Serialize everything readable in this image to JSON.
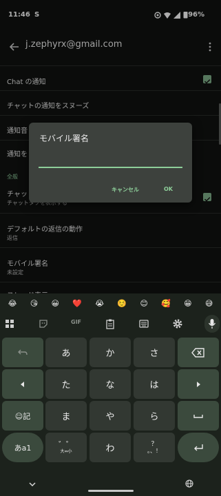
{
  "status": {
    "time": "11:46",
    "carrier_icon": "S",
    "battery": "96%"
  },
  "header": {
    "back_icon": "arrow-left-icon",
    "title": "j.zephyrx@gmail.com",
    "more_icon": "more-vert-icon"
  },
  "settings": {
    "rows": [
      {
        "title": "Chat の通知",
        "checked": true
      },
      {
        "title": "チャットの通知をスヌーズ"
      },
      {
        "title": "通知音"
      },
      {
        "title": "通知を"
      },
      {
        "section": "全般"
      },
      {
        "title": "チャッ",
        "subtitle": "チャットタブを表示する",
        "checked": true
      },
      {
        "title": "デフォルトの返信の動作",
        "subtitle": "返信"
      },
      {
        "title": "モバイル署名",
        "subtitle": "未設定"
      },
      {
        "title": "スレッド表示"
      }
    ]
  },
  "dialog": {
    "title": "モバイル署名",
    "input_value": "",
    "cancel": "キャンセル",
    "ok": "OK"
  },
  "emoji_row": [
    "😂",
    "😘",
    "😀",
    "❤️",
    "😭",
    "☺️",
    "😊",
    "🥰",
    "😁",
    "😅"
  ],
  "keyboard": {
    "toolbar": {
      "gif": "GIF"
    },
    "rows": [
      [
        "undo-icon",
        "あ",
        "か",
        "さ",
        "backspace-icon"
      ],
      [
        "left-arrow-icon",
        "た",
        "な",
        "は",
        "right-arrow-icon"
      ],
      [
        "☺記",
        "ま",
        "や",
        "ら",
        "space-icon"
      ],
      [
        "あa1",
        "゛゜小",
        "わ",
        "？。、！",
        "enter-icon"
      ]
    ],
    "labels": {
      "a": "あ",
      "ka": "か",
      "sa": "さ",
      "ta": "た",
      "na": "な",
      "ha": "は",
      "ma": "ま",
      "ya": "や",
      "ra": "ら",
      "wa": "わ",
      "emoji_kigo": "☺記",
      "mode": "あa1",
      "dakuten": "゛゜",
      "dakuten_sub": "大⇔小",
      "punct": "？",
      "punct_sub": "。、！"
    }
  },
  "colors": {
    "accent": "#8ecf9a",
    "background": "#111311",
    "dialog": "#3d413d",
    "key": "#323832",
    "key_fn": "#3b4a3d"
  }
}
